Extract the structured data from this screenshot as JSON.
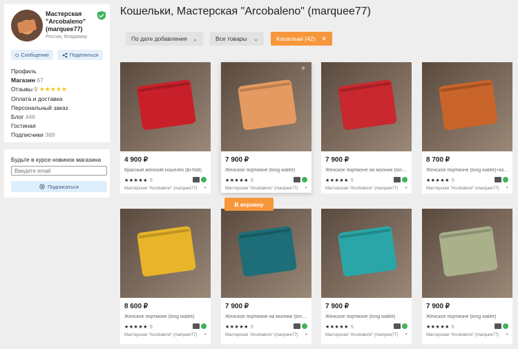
{
  "shop": {
    "name": "Мастерская \"Arcobaleno\" (marquee77)",
    "location": "Россия, Владимир",
    "message_label": "Сообщение",
    "share_label": "Поделиться"
  },
  "menu": {
    "profile": "Профиль",
    "shop_label": "Магазин",
    "shop_count": "67",
    "reviews_label": "Отзывы",
    "reviews_count": "9",
    "stars": "★★★★★",
    "payment": "Оплата и доставка",
    "personal_order": "Персональный заказ",
    "blog_label": "Блог",
    "blog_count": "446",
    "guest": "Гостиная",
    "subscribers_label": "Подписчики",
    "subscribers_count": "389"
  },
  "subscribe": {
    "title": "Будьте в курсе новинок магазина",
    "placeholder": "Введите email",
    "button": "Подписаться"
  },
  "page": {
    "title": "Кошельки, Мастерская \"Arcobaleno\" (marquee77)"
  },
  "filters": {
    "sort": "По дате добавления",
    "goods": "Все товары",
    "category": "Кошельки (42)"
  },
  "cart_button": "В корзину",
  "products": [
    {
      "price": "4 900 ₽",
      "name": "Красный женский кошелек (bi-fold)",
      "stars": "★★★★★",
      "rating": "5",
      "shop": "Мастерская \"Arcobaleno\" (marquee77)",
      "color": "#c8202a"
    },
    {
      "price": "7 900 ₽",
      "name": "Женское портмоне (long wallet)",
      "stars": "★★★★★",
      "rating": "5",
      "shop": "Мастерская \"Arcobaleno\" (marquee77)",
      "color": "#e59a62"
    },
    {
      "price": "7 900 ₽",
      "name": "Женское портмоне на молнии (long wallet)",
      "stars": "★★★★★",
      "rating": "5",
      "shop": "Мастерская \"Arcobaleno\" (marquee77)",
      "color": "#c8282e"
    },
    {
      "price": "8 700 ₽",
      "name": "Женское портмоне (long wallet)+кошелек",
      "stars": "★★★★★",
      "rating": "5",
      "shop": "Мастерская \"Arcobaleno\" (marquee77)",
      "color": "#c9642a"
    },
    {
      "price": "8 600 ₽",
      "name": "Женское портмоне (long wallet)",
      "stars": "★★★★★",
      "rating": "5",
      "shop": "Мастерская \"Arcobaleno\" (marquee77)",
      "color": "#e8b52a"
    },
    {
      "price": "7 900 ₽",
      "name": "Женское портмоне на молнии (long wallet)",
      "stars": "★★★★★",
      "rating": "5",
      "shop": "Мастерская \"Arcobaleno\" (marquee77)",
      "color": "#1d6e78"
    },
    {
      "price": "7 900 ₽",
      "name": "Женское портмоне (long wallet)",
      "stars": "★★★★★",
      "rating": "5",
      "shop": "Мастерская \"Arcobaleno\" (marquee77)",
      "color": "#2aa6a8"
    },
    {
      "price": "7 900 ₽",
      "name": "Женское портмоне (long wallet)",
      "stars": "★★★★★",
      "rating": "5",
      "shop": "Мастерская \"Arcobaleno\" (marquee77)",
      "color": "#a9b08a"
    }
  ]
}
